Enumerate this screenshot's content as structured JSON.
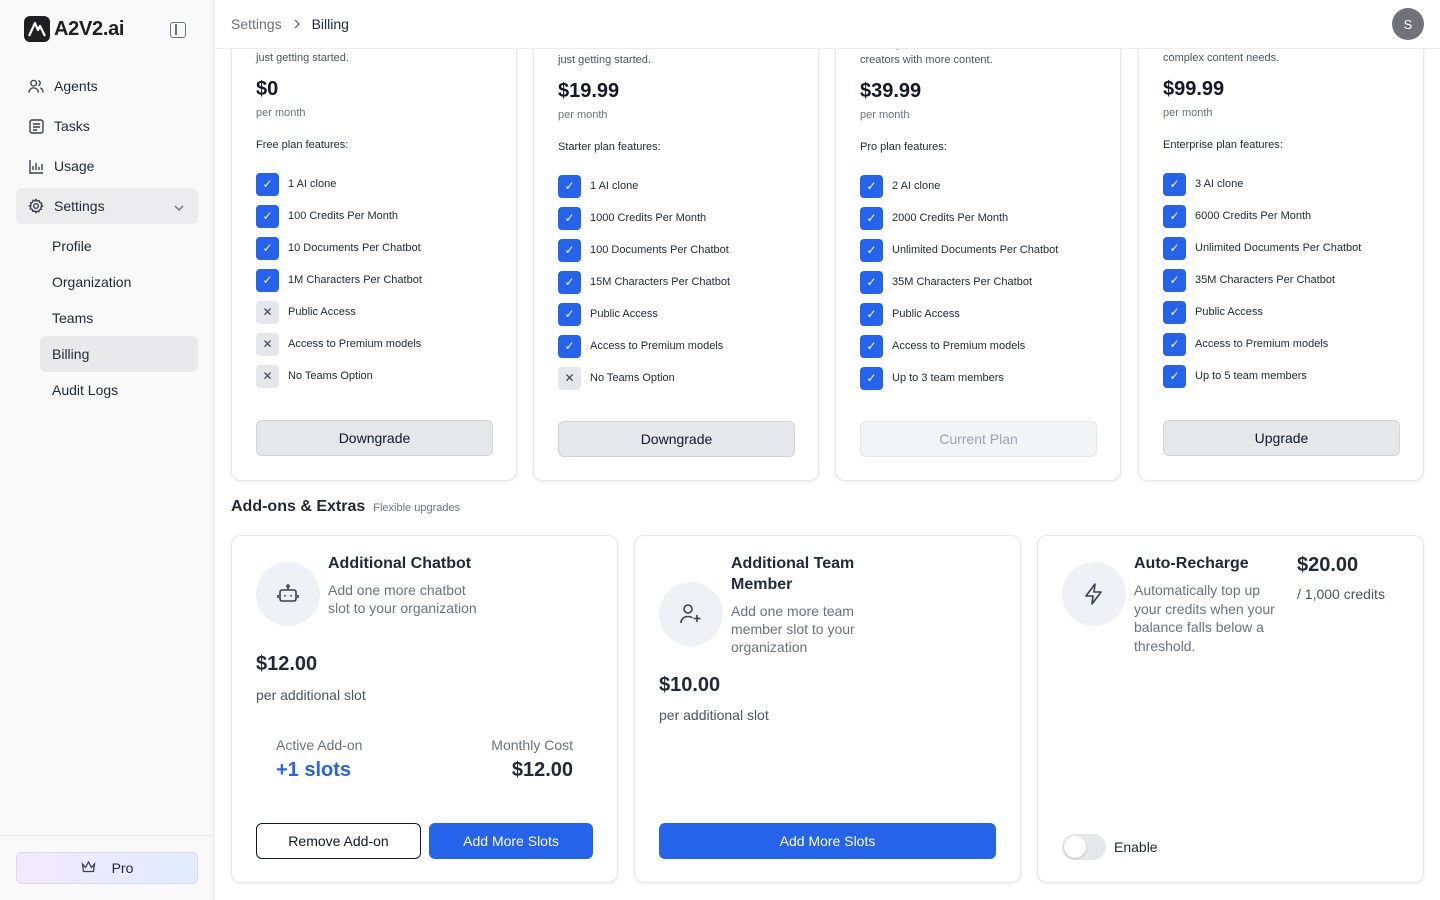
{
  "app": {
    "logo_mark": "A",
    "logo_text": "A2V2.ai"
  },
  "sidebar": {
    "items": [
      {
        "label": "Agents",
        "icon": "users-icon"
      },
      {
        "label": "Tasks",
        "icon": "tasks-icon"
      },
      {
        "label": "Usage",
        "icon": "chart-icon"
      },
      {
        "label": "Settings",
        "icon": "gear-icon"
      }
    ],
    "sub_items": [
      "Profile",
      "Organization",
      "Teams",
      "Billing",
      "Audit Logs"
    ],
    "active_sub": "Billing",
    "pro_label": "Pro"
  },
  "header": {
    "breadcrumb": [
      "Settings",
      "Billing"
    ],
    "avatar_initial": "S"
  },
  "plans": [
    {
      "desc": "Individual creators, small YouTubers, or those just getting started.",
      "price": "$0",
      "per": "per month",
      "features_label": "Free plan features:",
      "features": [
        {
          "text": "1 AI clone",
          "on": true
        },
        {
          "text": "100 Credits Per Month",
          "on": true
        },
        {
          "text": "10 Documents Per Chatbot",
          "on": true
        },
        {
          "text": "1M Characters Per Chatbot",
          "on": true
        },
        {
          "text": "Public Access",
          "on": false
        },
        {
          "text": "Access to Premium models",
          "on": false
        },
        {
          "text": "No Teams Option",
          "on": false
        }
      ],
      "button": "Downgrade",
      "disabled": false
    },
    {
      "desc": "Individual creators, small YouTubers, or those just getting started.",
      "price": "$19.99",
      "per": "per month",
      "features_label": "Starter plan features:",
      "features": [
        {
          "text": "1 AI clone",
          "on": true
        },
        {
          "text": "1000 Credits Per Month",
          "on": true
        },
        {
          "text": "100 Documents Per Chatbot",
          "on": true
        },
        {
          "text": "15M Characters Per Chatbot",
          "on": true
        },
        {
          "text": "Public Access",
          "on": true
        },
        {
          "text": "Access to Premium models",
          "on": true
        },
        {
          "text": "No Teams Option",
          "on": false
        }
      ],
      "button": "Downgrade",
      "disabled": false
    },
    {
      "desc": "Growing channels, small businesses, or creators with more content.",
      "price": "$39.99",
      "per": "per month",
      "features_label": "Pro plan features:",
      "features": [
        {
          "text": "2 AI clone",
          "on": true
        },
        {
          "text": "2000 Credits Per Month",
          "on": true
        },
        {
          "text": "Unlimited Documents Per Chatbot",
          "on": true
        },
        {
          "text": "35M Characters Per Chatbot",
          "on": true
        },
        {
          "text": "Public Access",
          "on": true
        },
        {
          "text": "Access to Premium models",
          "on": true
        },
        {
          "text": "Up to 3 team members",
          "on": true
        }
      ],
      "button": "Current Plan",
      "disabled": true
    },
    {
      "desc": "Large businesses, agencies, or creators with complex content needs.",
      "price": "$99.99",
      "per": "per month",
      "features_label": "Enterprise plan features:",
      "features": [
        {
          "text": "3 AI clone",
          "on": true
        },
        {
          "text": "6000 Credits Per Month",
          "on": true
        },
        {
          "text": "Unlimited Documents Per Chatbot",
          "on": true
        },
        {
          "text": "35M Characters Per Chatbot",
          "on": true
        },
        {
          "text": "Public Access",
          "on": true
        },
        {
          "text": "Access to Premium models",
          "on": true
        },
        {
          "text": "Up to 5 team members",
          "on": true
        }
      ],
      "button": "Upgrade",
      "disabled": false
    }
  ],
  "addons": {
    "title": "Add-ons & Extras",
    "subtitle": "Flexible upgrades",
    "chatbot": {
      "title": "Additional Chatbot",
      "desc": "Add one more chatbot slot to your organization",
      "price": "$12.00",
      "per": "per additional slot",
      "active_label": "Active Add-on",
      "active_value": "+1 slots",
      "cost_label": "Monthly Cost",
      "cost_value": "$12.00",
      "remove_button": "Remove Add-on",
      "add_button": "Add More Slots"
    },
    "team": {
      "title": "Additional Team Member",
      "desc": "Add one more team member slot to your organization",
      "price": "$10.00",
      "per": "per additional slot",
      "add_button": "Add More Slots"
    },
    "recharge": {
      "title": "Auto-Recharge",
      "desc": "Automatically top up your credits when your balance falls below a threshold.",
      "price": "$20.00",
      "per": "/ 1,000 credits",
      "toggle_label": "Enable",
      "enabled": false
    }
  },
  "colors": {
    "accent": "#2563eb",
    "check_off": "#e5e7eb"
  }
}
